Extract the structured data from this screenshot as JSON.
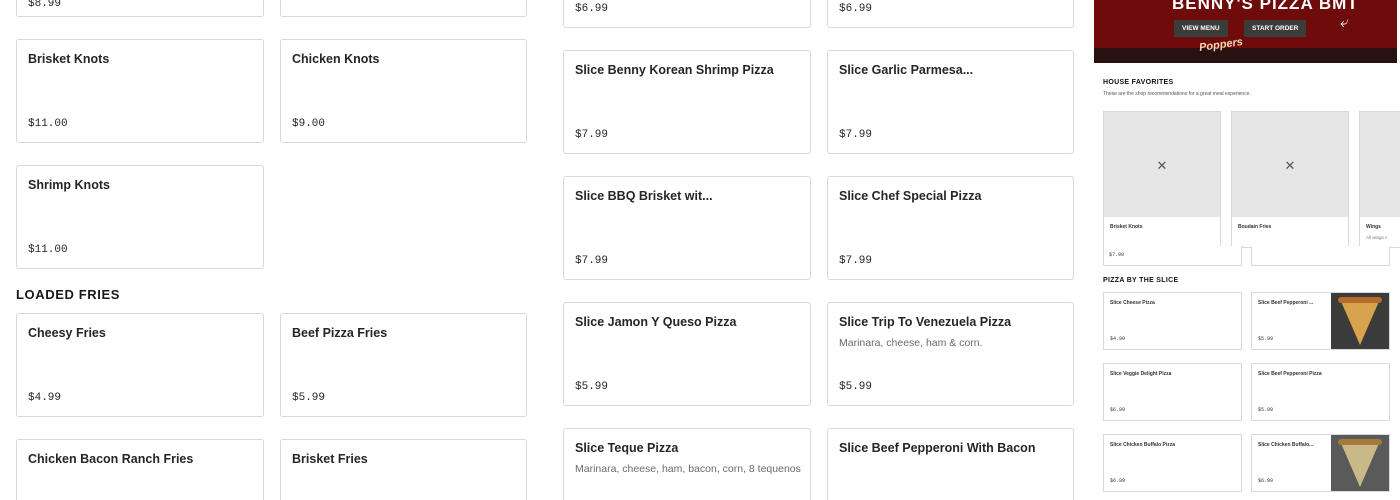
{
  "left_menu": {
    "top_partial": {
      "price_a": "$8.99"
    },
    "items": [
      {
        "name": "Brisket Knots",
        "price": "$11.00"
      },
      {
        "name": "Chicken Knots",
        "price": "$9.00"
      },
      {
        "name": "Shrimp Knots",
        "price": "$11.00"
      }
    ],
    "section_loaded_fries": "LOADED FRIES",
    "fries": [
      {
        "name": "Cheesy Fries",
        "price": "$4.99"
      },
      {
        "name": "Beef Pizza Fries",
        "price": "$5.99"
      },
      {
        "name": "Chicken Bacon Ranch Fries",
        "price": ""
      },
      {
        "name": "Brisket Fries",
        "price": ""
      }
    ]
  },
  "slice_menu": {
    "top_prices": [
      "$6.99",
      "$6.99"
    ],
    "items": [
      {
        "name": "Slice Benny Korean Shrimp Pizza",
        "desc": "",
        "price": "$7.99"
      },
      {
        "name": "Slice Garlic Parmesa...",
        "desc": "",
        "price": "$7.99"
      },
      {
        "name": "Slice BBQ Brisket wit...",
        "desc": "",
        "price": "$7.99"
      },
      {
        "name": "Slice Chef Special Pizza",
        "desc": "",
        "price": "$7.99"
      },
      {
        "name": "Slice Jamon Y Queso Pizza",
        "desc": "",
        "price": "$5.99"
      },
      {
        "name": "Slice Trip To Venezuela Pizza",
        "desc": "Marinara, cheese, ham & corn.",
        "price": "$5.99"
      },
      {
        "name": "Slice Teque Pizza",
        "desc": "Marinara, cheese, ham, bacon, corn, 8 tequenos",
        "price": ""
      },
      {
        "name": "Slice Beef Pepperoni With Bacon",
        "desc": "",
        "price": ""
      }
    ]
  },
  "preview": {
    "hero_title": "BENNY'S PIZZA BMT",
    "hero_sub": "Poppers",
    "view_menu": "VIEW MENU",
    "start_order": "START ORDER",
    "house_favorites": "HOUSE FAVORITES",
    "house_favorites_sub": "These are the shop recommendations for a great meal experience.",
    "favorites": [
      {
        "name": "Brisket Knots",
        "sub": ""
      },
      {
        "name": "Boudain Fries",
        "sub": ""
      },
      {
        "name": "Wings",
        "sub": "All wings c"
      }
    ],
    "fav_price": "$7.99",
    "section_slice": "PIZZA BY THE SLICE",
    "slices": [
      {
        "name": "Slice Cheese Pizza",
        "price": "$4.99"
      },
      {
        "name": "Slice Beef Pepperoni ...",
        "price": "$5.99"
      },
      {
        "name": "Slice Veggie Delight Pizza",
        "price": "$6.99"
      },
      {
        "name": "Slice Beef Pepperoni Pizza",
        "price": "$5.99"
      },
      {
        "name": "Slice Chicken Buffalo Pizza",
        "price": "$6.99"
      },
      {
        "name": "Slice Chicken Buffalo...",
        "price": "$6.99"
      }
    ]
  }
}
